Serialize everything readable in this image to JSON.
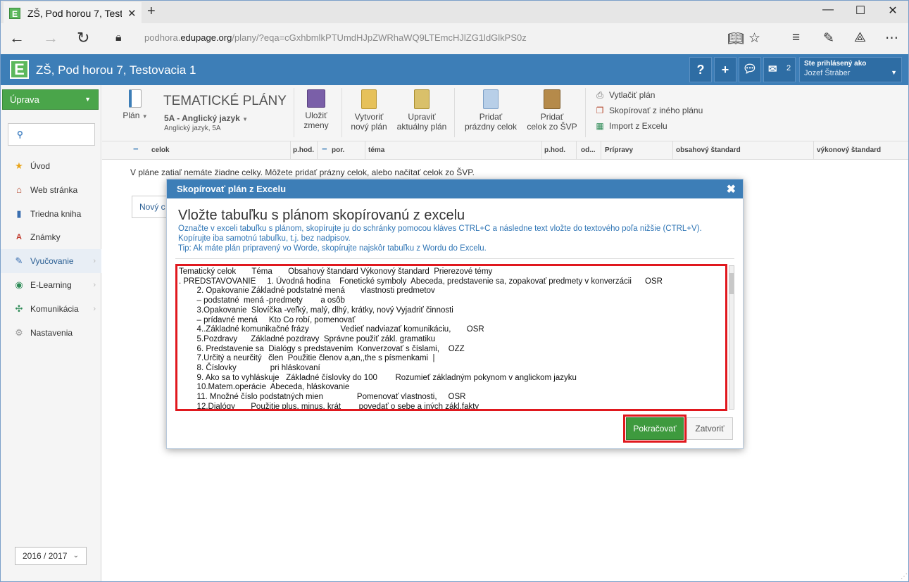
{
  "browser": {
    "tab_title": "ZŠ, Pod horou 7, Testova",
    "tab_close": "✕",
    "new_tab": "+",
    "url_prefix": "podhora.",
    "url_domain": "edupage.org",
    "url_path": "/plany/?eqa=cGxhbmlkPTUmdHJpZWRhaWQ9LTEmcHJlZG1ldGlkPS0z",
    "window_buttons": [
      "—",
      "☐",
      "✕"
    ]
  },
  "app": {
    "logo": "E",
    "school_name": "ZŠ, Pod horou 7, Testovacia 1",
    "help": "?",
    "add": "+",
    "messages_count": "2",
    "user_label": "Ste prihlásený ako",
    "user_name": "Jozef Štráber"
  },
  "sidebar": {
    "mode_button": "Úprava",
    "items": [
      {
        "label": "Úvod",
        "icon": "star-icon"
      },
      {
        "label": "Web stránka",
        "icon": "house-icon"
      },
      {
        "label": "Triedna kniha",
        "icon": "book-icon"
      },
      {
        "label": "Známky",
        "icon": "grade-icon"
      },
      {
        "label": "Vyučovanie",
        "icon": "teaching-icon"
      },
      {
        "label": "E-Learning",
        "icon": "globe-icon"
      },
      {
        "label": "Komunikácia",
        "icon": "network-icon"
      },
      {
        "label": "Nastavenia",
        "icon": "gear-icon"
      }
    ],
    "school_year": "2016 / 2017"
  },
  "toolbar": {
    "plan_label": "Plán",
    "title": "TEMATICKÉ PLÁNY",
    "class_subject": "5A - Anglický jazyk",
    "subtitle": "Anglický jazyk, 5A",
    "save": [
      "Uložiť",
      "zmeny"
    ],
    "create": [
      "Vytvoriť",
      "nový plán"
    ],
    "edit": [
      "Upraviť",
      "aktuálny plán"
    ],
    "add_empty": [
      "Pridať",
      "prázdny celok"
    ],
    "add_svp": [
      "Pridať",
      "celok zo ŠVP"
    ],
    "print": "Vytlačiť plán",
    "copy": "Skopírovať z iného plánu",
    "import": "Import z Excelu"
  },
  "table_header": {
    "minus1": "−",
    "celok": "celok",
    "phod1": "p.hod.",
    "minus2": "−",
    "por": "por.",
    "tema": "téma",
    "phod2": "p.hod.",
    "od": "od...",
    "pripravy": "Prípravy",
    "obsahovy": "obsahový štandard",
    "vykonovy": "výkonový štandard"
  },
  "main": {
    "empty_message": "V pláne zatiaľ nemáte žiadne celky. Môžete pridať prázny celok, alebo načítať celok zo ŠVP.",
    "new_button": "Nový c"
  },
  "dialog": {
    "header": "Skopírovať plán z Excelu",
    "close": "✖",
    "title": "Vložte tabuľku s plánom skopírovanú z excelu",
    "info1": "Označte v exceli tabuľku s plánom, skopírujte ju do schránky pomocou kláves CTRL+C a následne text vložte do textového poľa nižšie (CTRL+V).",
    "info2": "Kopírujte iba samotnú tabuľku, t.j. bez nadpisov.",
    "info3": "Tip: Ak máte plán pripravený vo Worde, skopírujte najskôr tabuľku z Wordu do Excelu.",
    "textarea": "Tematický celok       Téma       Obsahový štandard Výkonový štandard  Prierezové témy\n. PREDSTAVOVANIE     1. Úvodná hodina    Fonetické symboly  Abeceda, predstavenie sa, zopakovať predmety v konverzácii      OSR\n        2. Opakovanie Základné podstatné mená       vlastnosti predmetov\n        – podstatné  mená -predmety        a osôb\n        3.Opakovanie  Slovíčka -veľký, malý, dlhý, krátky, nový Vyjadriť činnosti\n        – prídavné mená     Kto Co robí, pomenovať\n        4..Základné komunikačné frázy              Vedieť nadviazať komunikáciu,       OSR\n        5.Pozdravy      Základné pozdravy  Správne použiť zákl. gramatiku\n        6. Predstavenie sa  Dialógy s predstavením  Konverzovať s číslami,    OZZ\n        7.Určitý a neurčitý   člen  Použitie členov a,an,,the s písmenkami  |\n        8. Číslovky               pri hláskovaní\n        9. Ako sa to vyhláskuje   Základné číslovky do 100        Rozumieť základným pokynom v anglickom jazyku\n        10.Matem.operácie  Abeceda, hláskovanie\n        11. Množné číslo podstatných mien               Pomenovať vlastnosti,     OSR\n        12.Dialógy       Použitie plus, minus, krát        povedať o sebe a iných zákl.fakty",
    "continue": "Pokračovať",
    "cancel": "Zatvoriť"
  }
}
